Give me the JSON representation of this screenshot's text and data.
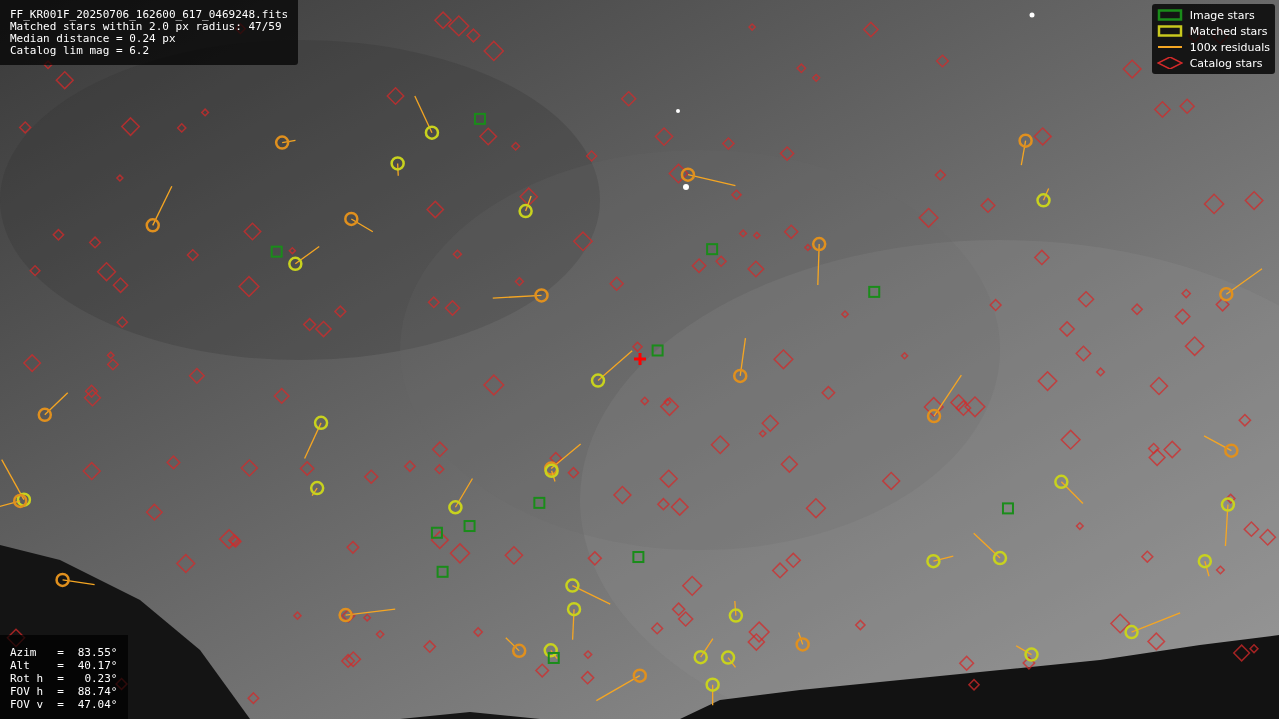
{
  "info": {
    "lines": [
      "FF_KR001F_20250706_162600_617_0469248.fits",
      "Matched stars within 2.0 px radius: 47/59",
      "Median distance = 0.24 px",
      "Catalog lim mag = 6.2"
    ]
  },
  "legend": [
    {
      "kind": "square",
      "label": "Image stars",
      "color": "#1a8c1a"
    },
    {
      "kind": "square",
      "label": "Matched stars",
      "color": "#c8c81e"
    },
    {
      "kind": "line",
      "label": "100x residuals",
      "color": "#f5a623"
    },
    {
      "kind": "diamond",
      "label": "Catalog stars",
      "color": "#d42a2a"
    }
  ],
  "pointing": [
    {
      "label": "Azim",
      "sep": "=",
      "value": "83.55°"
    },
    {
      "label": "Alt",
      "sep": "=",
      "value": "40.17°"
    },
    {
      "label": "Rot h",
      "sep": "=",
      "value": "0.23°"
    },
    {
      "label": "FOV h",
      "sep": "=",
      "value": "88.74°"
    },
    {
      "label": "FOV v",
      "sep": "=",
      "value": "47.04°"
    }
  ]
}
